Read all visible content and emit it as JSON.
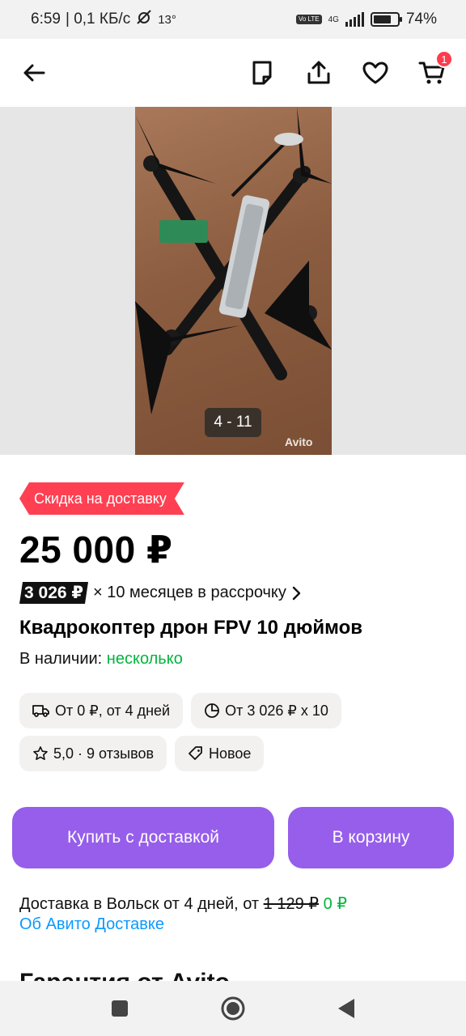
{
  "status_bar": {
    "time": "6:59",
    "network_speed": "| 0,1 КБ/с",
    "temperature": "13°",
    "network_type": "4G",
    "volte_label": "Vo LTE",
    "battery": "74%",
    "battery_level": 0.74
  },
  "toolbar": {
    "back_icon": "arrow-left-icon",
    "note_icon": "note-icon",
    "share_icon": "share-icon",
    "favorite_icon": "heart-icon",
    "cart_icon": "cart-icon",
    "cart_badge": "1"
  },
  "gallery": {
    "counter": "4 - 11",
    "watermark": "Avito"
  },
  "listing": {
    "discount_ribbon": "Скидка на доставку",
    "price": "25 000 ₽",
    "installment_amount": "3 026 ₽",
    "installment_text": "× 10 месяцев в рассрочку",
    "title": "Квадрокоптер дрон FPV 10 дюймов",
    "stock_label": "В наличии:",
    "stock_value": "несколько"
  },
  "chips": [
    {
      "icon": "truck-icon",
      "label": "От 0 ₽, от 4 дней"
    },
    {
      "icon": "pie-chart-icon",
      "label": "От 3 026 ₽ x 10"
    },
    {
      "icon": "star-icon",
      "label": "5,0 · 9 отзывов"
    },
    {
      "icon": "tag-icon",
      "label": "Новое"
    }
  ],
  "actions": {
    "buy_label": "Купить с доставкой",
    "cart_label": "В корзину",
    "accent_color": "#965eeb"
  },
  "delivery": {
    "text": "Доставка в Вольск от 4 дней, от",
    "old_price": "1 129 ₽",
    "new_price": "0 ₽",
    "link": "Об Авито Доставке"
  },
  "next_section_title": "Гарантия от Avito",
  "colors": {
    "discount": "#ff4053",
    "success": "#02b53d",
    "link": "#0a9aff"
  }
}
